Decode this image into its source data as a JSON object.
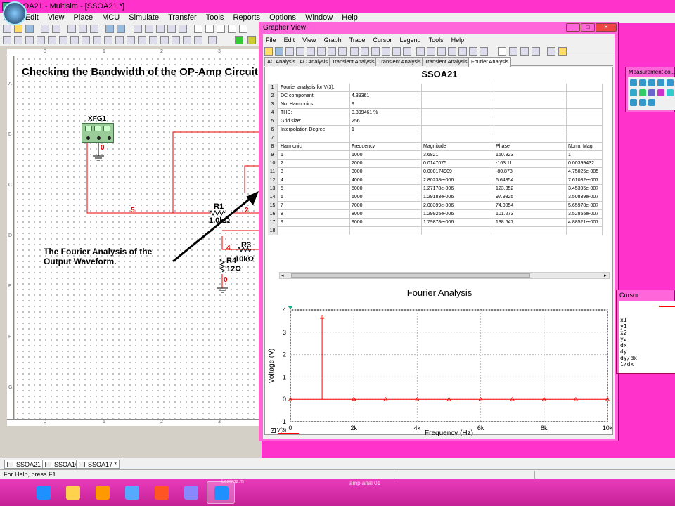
{
  "main": {
    "title": "SSOA21 - Multisim - [SSOA21 *]",
    "menu": [
      "File",
      "Edit",
      "View",
      "Place",
      "MCU",
      "Simulate",
      "Transfer",
      "Tools",
      "Reports",
      "Options",
      "Window",
      "Help"
    ]
  },
  "schematic": {
    "title": "Checking the Bandwidth of the OP-Amp Circuit",
    "ruler_top": [
      "0",
      "1",
      "2",
      "3"
    ],
    "ruler_left": [
      "A",
      "B",
      "C",
      "D",
      "E",
      "F",
      "G"
    ],
    "ruler_bottom": [
      "0",
      "1",
      "2",
      "3"
    ],
    "xfg": "XFG1",
    "xfg_node": "0",
    "r1_name": "R1",
    "r1_value": "1.0kΩ",
    "r3_name": "R3",
    "r3_value": "10kΩ",
    "r4_name": "R4",
    "r4_value": "12Ω",
    "node5": "5",
    "node2": "2",
    "node4": "4",
    "node0": "0",
    "annotation_line1": "The Fourier Analysis of the",
    "annotation_line2": "Output Waveform."
  },
  "doc_tabs": [
    "SSOA21 *",
    "SSOA16",
    "SSOA17 *"
  ],
  "status": "For Help, press F1",
  "taskbar": {
    "hint1": "Lesmsz.m",
    "hint2": "amp anal 01",
    "colors": [
      "#1e90ff",
      "#ffd24d",
      "#ff9900",
      "#55aaff",
      "#ff5522",
      "#8888ff"
    ]
  },
  "grapher": {
    "title": "Grapher View",
    "menu": [
      "File",
      "Edit",
      "View",
      "Graph",
      "Trace",
      "Cursor",
      "Legend",
      "Tools",
      "Help"
    ],
    "tabs": [
      "AC Analysis",
      "AC Analysis",
      "Transient Analysis",
      "Transient Analysis",
      "Transient Analysis",
      "Fourier Analysis"
    ],
    "sheet_title": "SSOA21",
    "table_rows": [
      {
        "n": "1",
        "c": [
          "Fourier analysis for V(3):",
          "",
          "",
          "",
          ""
        ]
      },
      {
        "n": "2",
        "c": [
          "DC component:",
          "4.39361",
          "",
          "",
          ""
        ]
      },
      {
        "n": "3",
        "c": [
          "No. Harmonics:",
          "9",
          "",
          "",
          ""
        ]
      },
      {
        "n": "4",
        "c": [
          "THD:",
          "0.399461 %",
          "",
          "",
          ""
        ]
      },
      {
        "n": "5",
        "c": [
          "Grid size:",
          "256",
          "",
          "",
          ""
        ]
      },
      {
        "n": "6",
        "c": [
          "Interpolation Degree:",
          "1",
          "",
          "",
          ""
        ]
      },
      {
        "n": "7",
        "c": [
          "",
          "",
          "",
          "",
          ""
        ]
      },
      {
        "n": "8",
        "c": [
          "Harmonic",
          "Frequency",
          "Magnitude",
          "Phase",
          "Norm. Mag"
        ]
      },
      {
        "n": "9",
        "c": [
          "1",
          "1000",
          "3.6821",
          "160.923",
          "1"
        ]
      },
      {
        "n": "10",
        "c": [
          "2",
          "2000",
          "0.0147075",
          "-163.11",
          "0.00399432"
        ]
      },
      {
        "n": "11",
        "c": [
          "3",
          "3000",
          "0.000174909",
          "-80.878",
          "4.75025e-005"
        ]
      },
      {
        "n": "12",
        "c": [
          "4",
          "4000",
          "2.80238e-006",
          "6.64854",
          "7.61082e-007"
        ]
      },
      {
        "n": "13",
        "c": [
          "5",
          "5000",
          "1.27178e-006",
          "123.352",
          "3.45395e-007"
        ]
      },
      {
        "n": "14",
        "c": [
          "6",
          "6000",
          "1.29183e-006",
          "97.9825",
          "3.50839e-007"
        ]
      },
      {
        "n": "15",
        "c": [
          "7",
          "7000",
          "2.08399e-006",
          "74.0054",
          "5.65978e-007"
        ]
      },
      {
        "n": "16",
        "c": [
          "8",
          "8000",
          "1.29925e-006",
          "101.273",
          "3.52855e-007"
        ]
      },
      {
        "n": "17",
        "c": [
          "9",
          "9000",
          "1.79878e-006",
          "138.647",
          "4.88521e-007"
        ]
      },
      {
        "n": "18",
        "c": [
          "",
          "",
          "",
          "",
          ""
        ]
      }
    ],
    "legend_label": "V(3)"
  },
  "chart_data": {
    "type": "line",
    "title": "Fourier Analysis",
    "xlabel": "Frequency (Hz)",
    "ylabel": "Voltage (V)",
    "xlim": [
      0,
      10000
    ],
    "ylim": [
      -1,
      4
    ],
    "xticks": [
      0,
      2000,
      4000,
      6000,
      8000,
      10000
    ],
    "xtick_labels": [
      "0",
      "2k",
      "4k",
      "6k",
      "8k",
      "10k"
    ],
    "yticks": [
      -1,
      0,
      1,
      2,
      3,
      4
    ],
    "ytick_labels": [
      "-1",
      "0",
      "1",
      "2",
      "3",
      "4"
    ],
    "grid": true,
    "series": [
      {
        "name": "V(3)",
        "color": "#ff0000",
        "x": [
          0,
          1000,
          2000,
          3000,
          4000,
          5000,
          6000,
          7000,
          8000,
          9000,
          10000
        ],
        "values": [
          0,
          3.6821,
          0.0147,
          0.0002,
          0,
          0,
          0,
          0,
          0,
          0,
          0
        ]
      }
    ]
  },
  "measure": {
    "title": "Measurement co..."
  },
  "cursor": {
    "title": "Cursor",
    "rows": [
      "x1",
      "y1",
      "x2",
      "y2",
      "dx",
      "dy",
      "dy/dx",
      "1/dx"
    ]
  }
}
